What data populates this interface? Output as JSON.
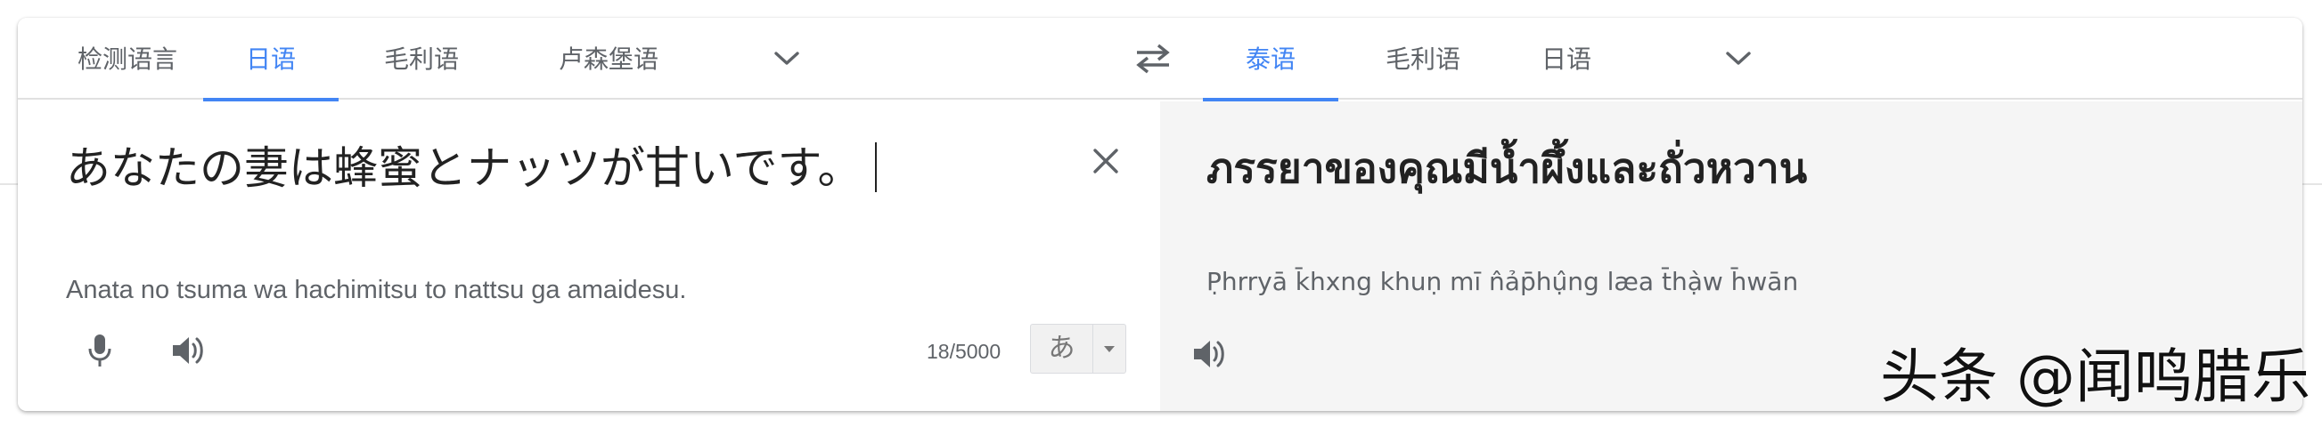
{
  "source_languages": {
    "tabs": [
      {
        "label": "检测语言",
        "active": false
      },
      {
        "label": "日语",
        "active": true
      },
      {
        "label": "毛利语",
        "active": false
      },
      {
        "label": "卢森堡语",
        "active": false
      }
    ],
    "more_icon": "chevron-down-icon"
  },
  "swap_icon": "swap-icon",
  "target_languages": {
    "tabs": [
      {
        "label": "泰语",
        "active": true
      },
      {
        "label": "毛利语",
        "active": false
      },
      {
        "label": "日语",
        "active": false
      }
    ],
    "more_icon": "chevron-down-icon"
  },
  "source": {
    "text": "あなたの妻は蜂蜜とナッツが甘いです。",
    "transliteration": "Anata no tsuma wa hachimitsu to nattsu ga amaidesu.",
    "char_count": "18/5000",
    "ime_label": "あ",
    "icons": [
      "microphone-icon",
      "speaker-icon",
      "close-icon"
    ]
  },
  "target": {
    "text": "ภรรยาของคุณมีน้ำผึ้งและถั่วหวาน",
    "romanization": "P̣hrryā k̄hxng khuṇ mī n̂ảp̄hụ̂ng læa t̄hạ̀w h̄wān",
    "icons": [
      "speaker-icon"
    ]
  },
  "watermark": "头条 @闻鸣腊乐",
  "colors": {
    "accent": "#4285f4",
    "text_primary": "#222222",
    "text_secondary": "#5f6368",
    "target_bg": "#f5f5f5"
  }
}
